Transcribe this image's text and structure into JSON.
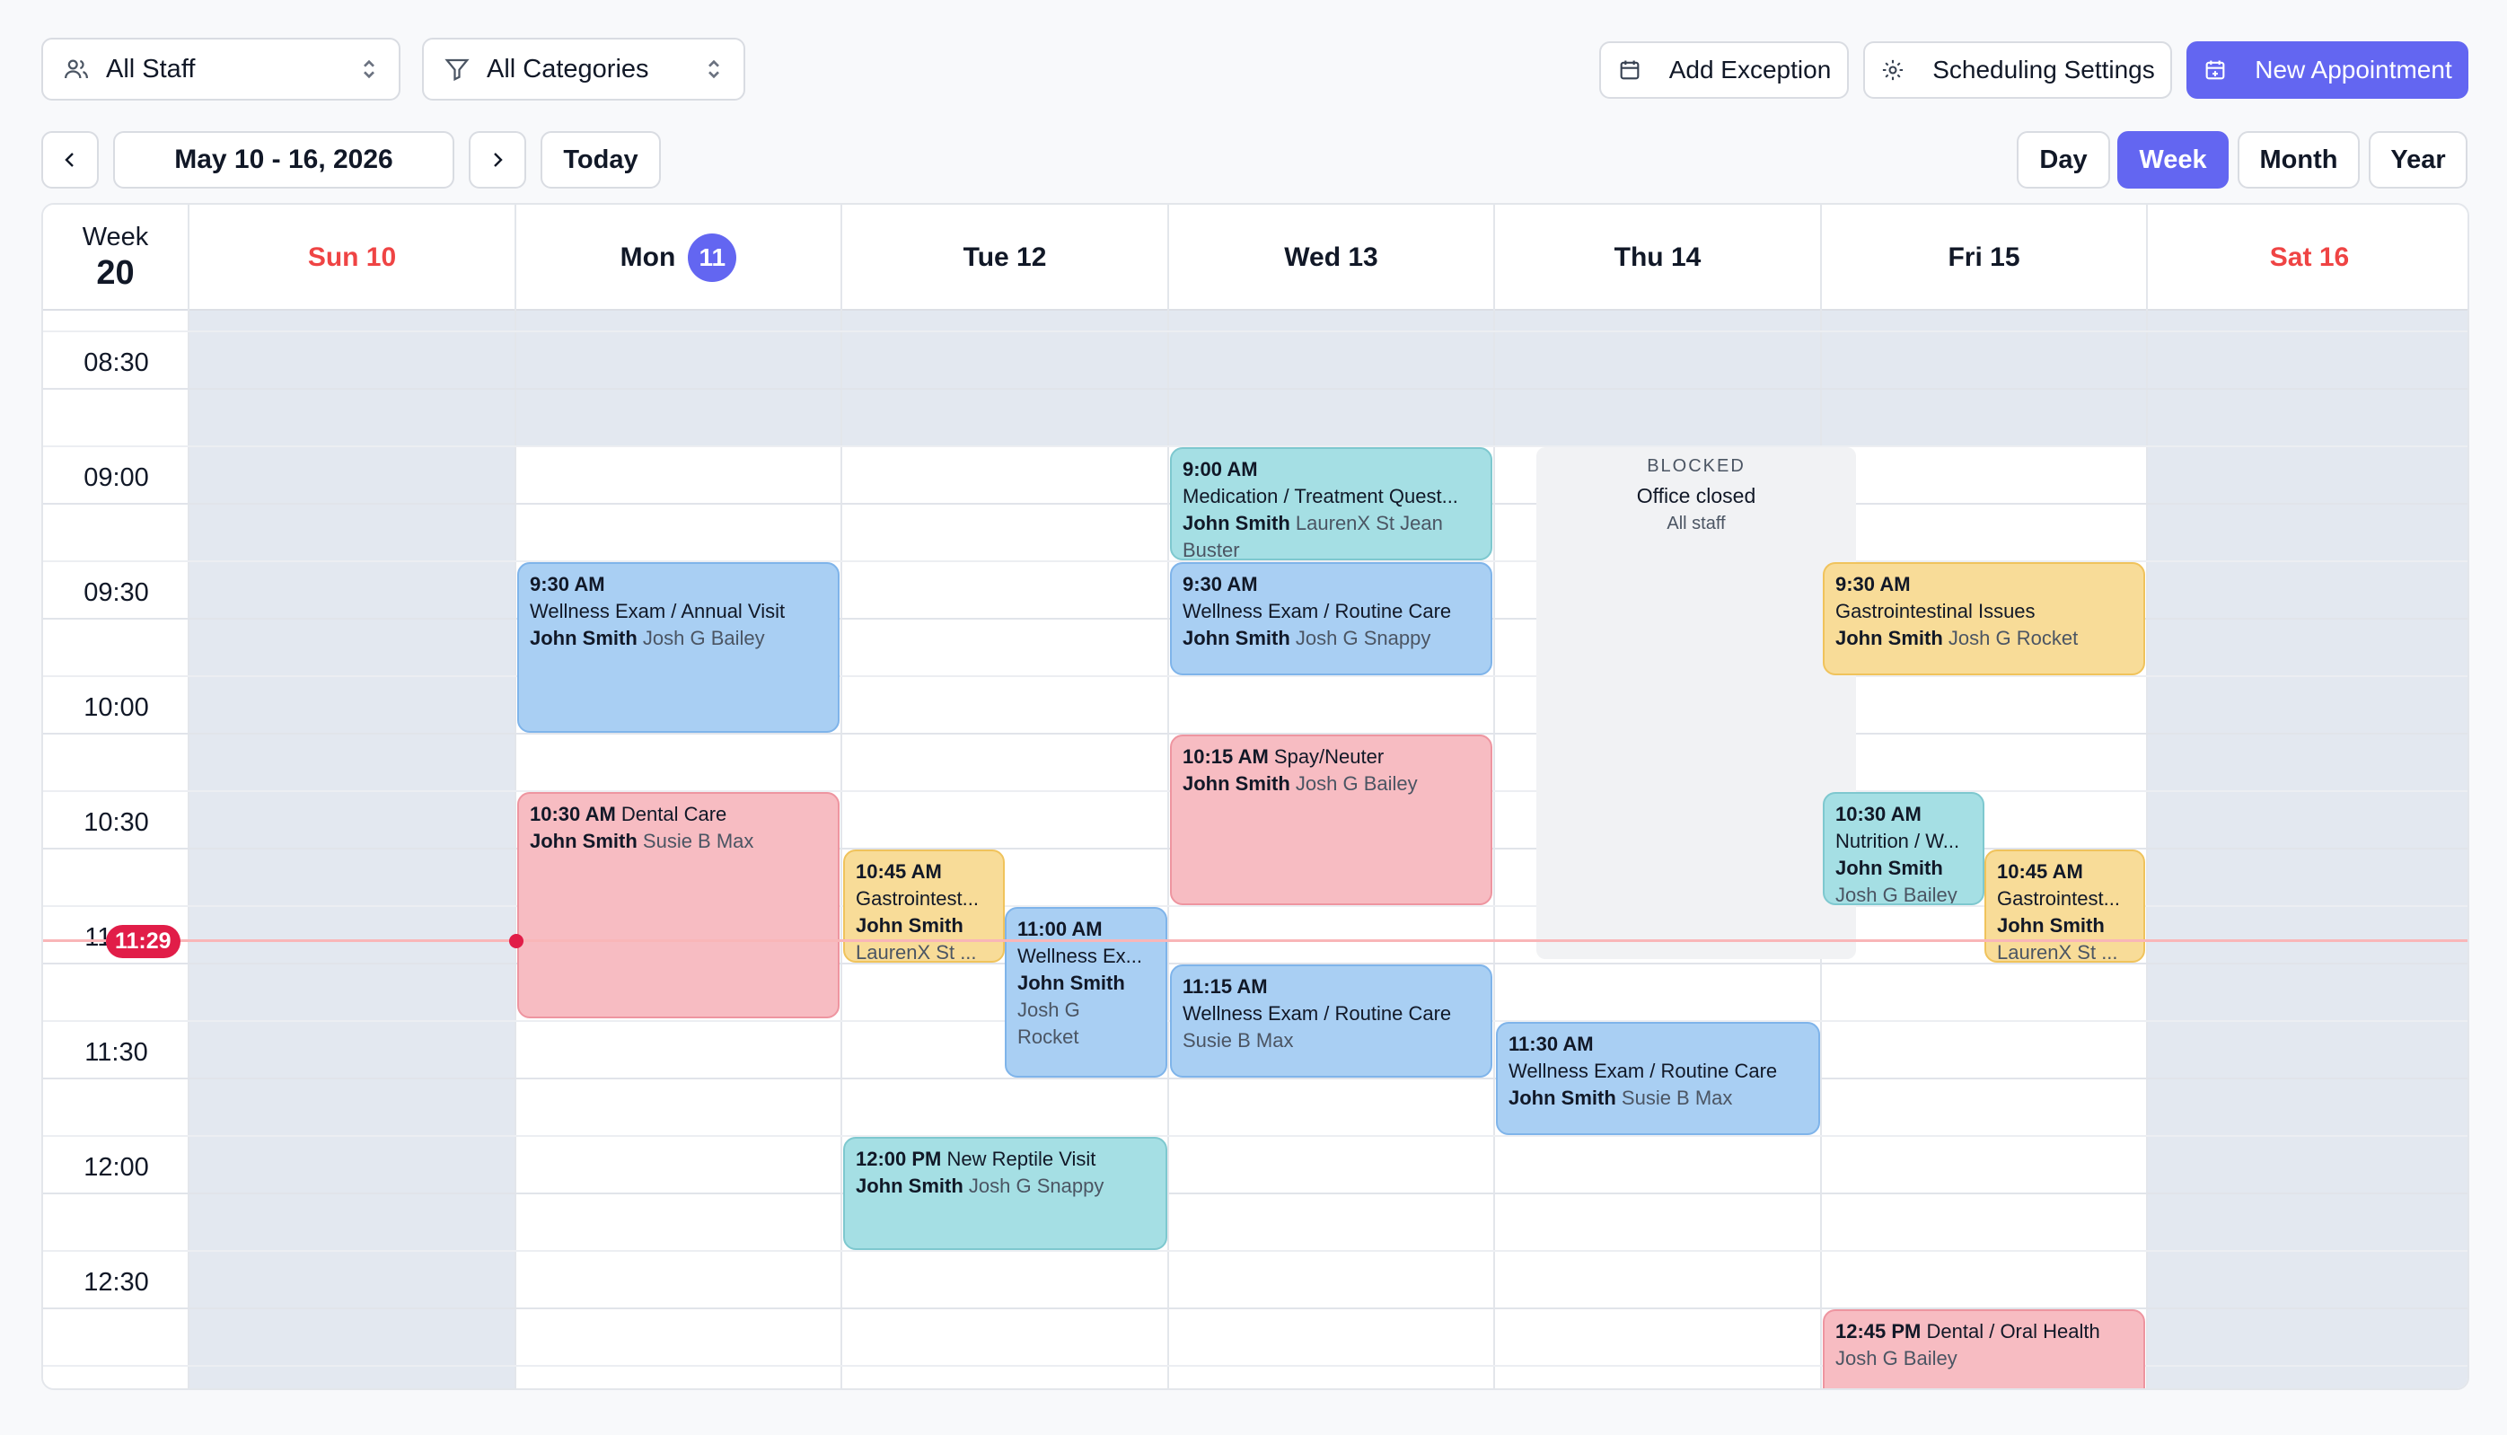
{
  "filters": {
    "staff": "All Staff",
    "categories": "All Categories"
  },
  "actions": {
    "add_exception": "Add Exception",
    "scheduling_settings": "Scheduling Settings",
    "new_appointment": "New Appointment"
  },
  "nav": {
    "date_range": "May 10 - 16, 2026",
    "today": "Today"
  },
  "views": {
    "day": "Day",
    "week": "Week",
    "month": "Month",
    "year": "Year",
    "active": "Week"
  },
  "week": {
    "label": "Week",
    "number": "20"
  },
  "days": [
    {
      "label": "Sun 10",
      "weekend": true
    },
    {
      "label": "Mon",
      "badge": "11",
      "today": true
    },
    {
      "label": "Tue 12"
    },
    {
      "label": "Wed 13"
    },
    {
      "label": "Thu 14"
    },
    {
      "label": "Fri 15"
    },
    {
      "label": "Sat 16",
      "weekend": true
    }
  ],
  "times": [
    "08:30",
    "09:00",
    "09:30",
    "10:00",
    "10:30",
    "11:00",
    "11:30",
    "12:00",
    "12:30"
  ],
  "now": "11:29",
  "blocked": {
    "label": "BLOCKED",
    "reason": "Office closed",
    "scope": "All staff"
  },
  "events": {
    "mon1": {
      "time": "9:30 AM",
      "title": "Wellness Exam / Annual Visit",
      "client": "John Smith",
      "patient": "Josh G Bailey"
    },
    "mon2": {
      "time": "10:30 AM",
      "title": "Dental Care",
      "client": "John Smith",
      "patient": "Susie B Max"
    },
    "tue1": {
      "time": "10:45 AM",
      "title": "Gastrointest...",
      "client": "John Smith",
      "patient": "LaurenX St ..."
    },
    "tue2": {
      "time": "11:00 AM",
      "title": "Wellness Ex...",
      "client": "John Smith",
      "patient1": "Josh G",
      "patient2": "Rocket"
    },
    "tue3": {
      "time": "12:00 PM",
      "title": "New Reptile Visit",
      "client": "John Smith",
      "patient": "Josh G Snappy"
    },
    "wed1": {
      "time": "9:00 AM",
      "title": "Medication / Treatment Quest...",
      "client": "John Smith",
      "patient": "LaurenX St Jean",
      "patient2": "Buster"
    },
    "wed2": {
      "time": "9:30 AM",
      "title": "Wellness Exam / Routine Care",
      "client": "John Smith",
      "patient": "Josh G Snappy"
    },
    "wed3": {
      "time": "10:15 AM",
      "title": "Spay/Neuter",
      "client": "John Smith",
      "patient": "Josh G Bailey"
    },
    "wed4": {
      "time": "11:15 AM",
      "title": "Wellness Exam / Routine Care",
      "patient": "Susie B Max"
    },
    "thu1": {
      "time": "11:30 AM",
      "title": "Wellness Exam / Routine Care",
      "client": "John Smith",
      "patient": "Susie B Max"
    },
    "fri1": {
      "time": "9:30 AM",
      "title": "Gastrointestinal Issues",
      "client": "John Smith",
      "patient": "Josh G Rocket"
    },
    "fri2": {
      "time": "10:30 AM",
      "title": "Nutrition / W...",
      "client": "John Smith",
      "patient": "Josh G Bailey"
    },
    "fri3": {
      "time": "10:45 AM",
      "title": "Gastrointest...",
      "client": "John Smith",
      "patient": "LaurenX St ..."
    },
    "fri4": {
      "time": "12:45 PM",
      "title": "Dental / Oral Health",
      "patient": "Josh G Bailey"
    }
  },
  "colors": {
    "accent": "#6366f1",
    "weekend": "#ef4444",
    "now": "#e11d48",
    "blue": "#a9cff3",
    "teal": "#a5dfe4",
    "pink": "#f7bcc2",
    "yellow": "#f8dc98"
  }
}
